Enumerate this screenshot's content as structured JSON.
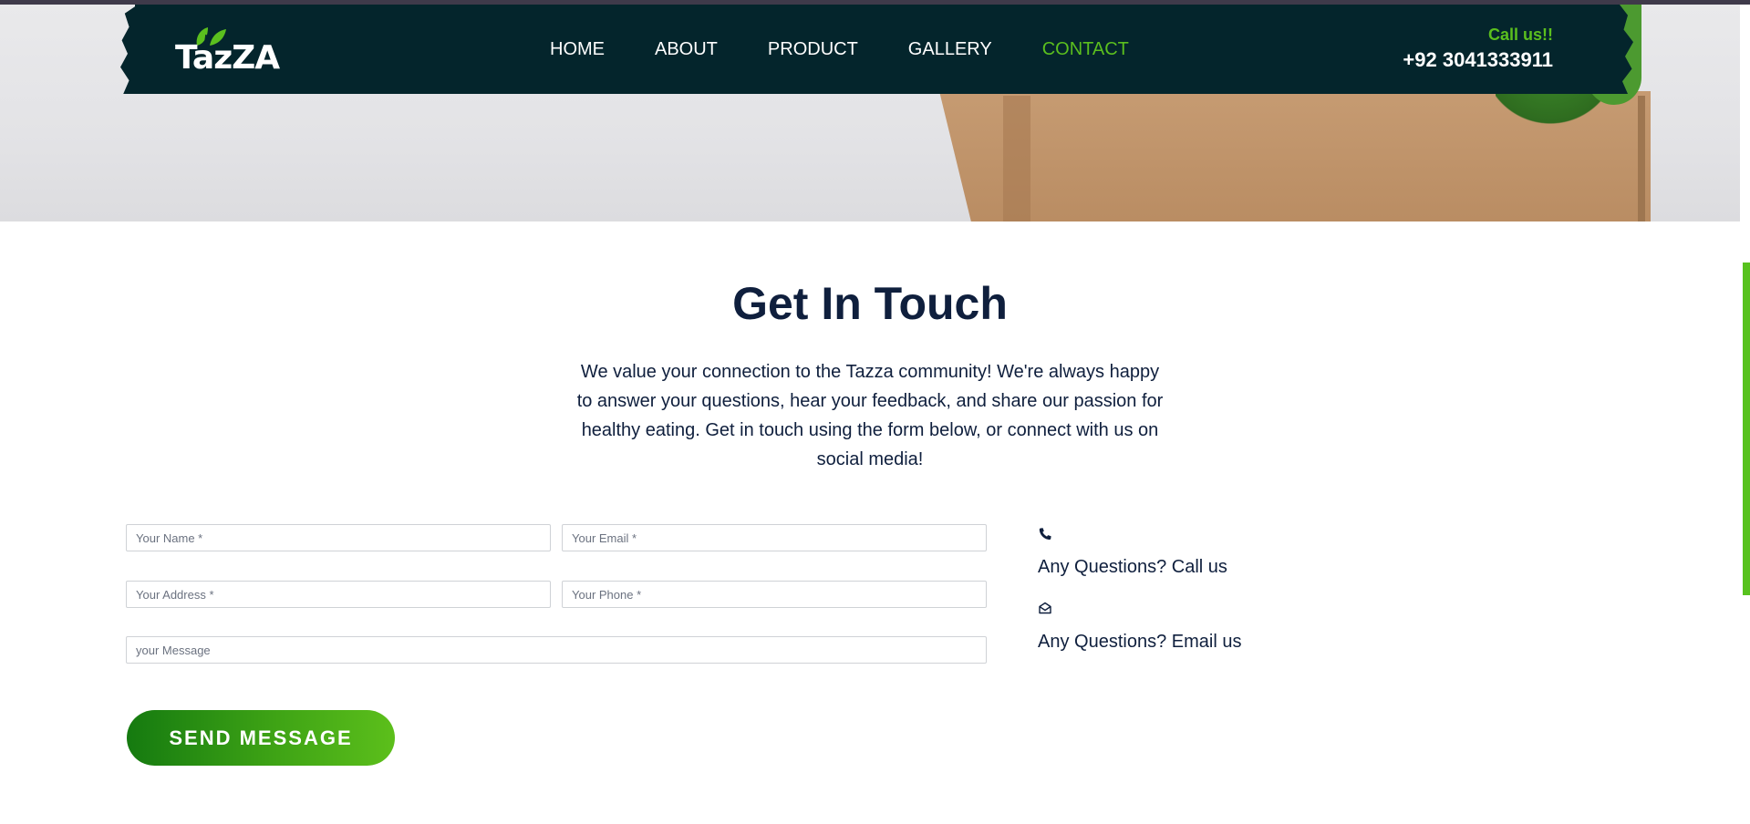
{
  "brand": {
    "name": "TazZA"
  },
  "nav": {
    "items": [
      {
        "label": "HOME",
        "active": false
      },
      {
        "label": "ABOUT",
        "active": false
      },
      {
        "label": "PRODUCT",
        "active": false
      },
      {
        "label": "GALLERY",
        "active": false
      },
      {
        "label": "CONTACT",
        "active": true
      }
    ]
  },
  "header_contact": {
    "label": "Call us!!",
    "phone": "+92 3041333911"
  },
  "section": {
    "title": "Get In Touch",
    "intro": "We value your connection to the Tazza community! We're always happy to answer your questions, hear your feedback, and share our passion for healthy eating. Get in touch using the form below, or connect with us on social media!"
  },
  "form": {
    "name_placeholder": "Your Name *",
    "email_placeholder": "Your Email *",
    "address_placeholder": "Your Address *",
    "phone_placeholder": "Your Phone *",
    "message_placeholder": "your Message",
    "submit_label": "SEND MESSAGE"
  },
  "contact_info": {
    "call": {
      "icon": "phone-icon",
      "text": "Any Questions? Call us"
    },
    "email": {
      "icon": "envelope-open-icon",
      "text": "Any Questions? Email us"
    }
  },
  "colors": {
    "nav_bg": "#04252c",
    "accent_green": "#5bbf1e",
    "button_gradient_start": "#157a10",
    "button_gradient_end": "#5cbf1b",
    "text_dark": "#0f1f3d"
  }
}
